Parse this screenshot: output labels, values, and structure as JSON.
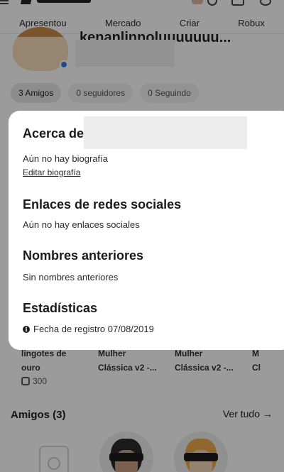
{
  "nav": {
    "tabs": [
      "Apresentou",
      "Mercado",
      "Criar",
      "Robux"
    ]
  },
  "profile": {
    "username": "kenanlinnoluuuuuuu...",
    "pills": [
      "3 Amigos",
      "0 seguidores",
      "0 Seguindo"
    ]
  },
  "inventory": {
    "items": [
      {
        "line1": "lingotes de",
        "line2": "ouro"
      },
      {
        "line1": "Mulher",
        "line2": "Clássica v2 -..."
      },
      {
        "line1": "Mulher",
        "line2": "Clássica v2 -..."
      },
      {
        "line1": "M",
        "line2": "Cl"
      }
    ],
    "price": "300"
  },
  "friends": {
    "heading": "Amigos  (3)",
    "see_all": "Ver tudo"
  },
  "modal": {
    "about_title": "Acerca de",
    "bio_text": "Aún no hay biografía",
    "edit_bio": "Editar biografía",
    "social_title": "Enlaces de redes sociales",
    "social_text": "Aún no hay enlaces sociales",
    "past_names_title": "Nombres anteriores",
    "past_names_text": "Sin nombres anteriores",
    "stats_title": "Estadísticas",
    "join_date": "Fecha de registro 07/08/2019"
  }
}
